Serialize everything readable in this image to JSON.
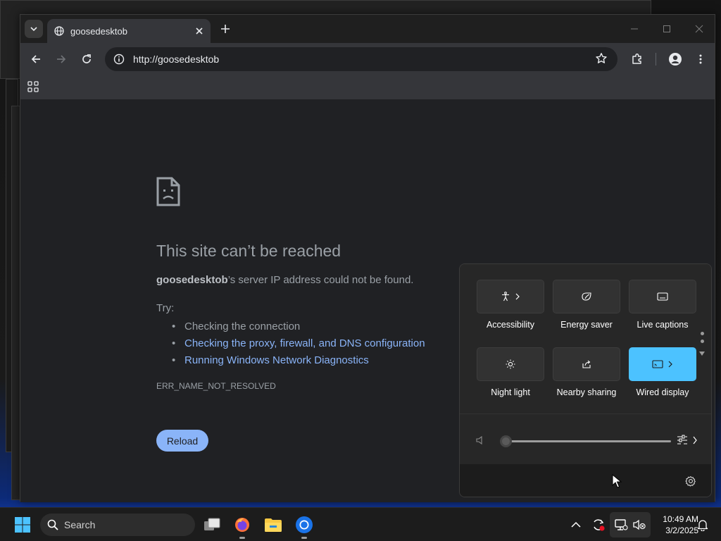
{
  "browser": {
    "tab": {
      "title": "goosedesktob"
    },
    "omnibox": {
      "url": "http://goosedesktob"
    }
  },
  "error_page": {
    "title": "This site can’t be reached",
    "host": "goosedesktob",
    "summary_rest": "’s server IP address could not be found.",
    "try_label": "Try:",
    "suggestions": [
      "Checking the connection",
      "Checking the proxy, firewall, and DNS configuration",
      "Running Windows Network Diagnostics"
    ],
    "error_code": "ERR_NAME_NOT_RESOLVED",
    "reload_label": "Reload"
  },
  "quick_settings": {
    "tiles": [
      {
        "label": "Accessibility",
        "icon": "accessibility-icon",
        "active": false
      },
      {
        "label": "Energy saver",
        "icon": "energy-saver-icon",
        "active": false
      },
      {
        "label": "Live captions",
        "icon": "live-captions-icon",
        "active": false
      },
      {
        "label": "Night light",
        "icon": "night-light-icon",
        "active": false
      },
      {
        "label": "Nearby sharing",
        "icon": "nearby-sharing-icon",
        "active": false
      },
      {
        "label": "Wired display",
        "icon": "wired-display-icon",
        "active": true
      }
    ],
    "volume_level": 0,
    "accent_color": "#4cc2ff"
  },
  "taskbar": {
    "search_label": "Search",
    "time": "10:49 AM",
    "date": "3/2/2025"
  }
}
